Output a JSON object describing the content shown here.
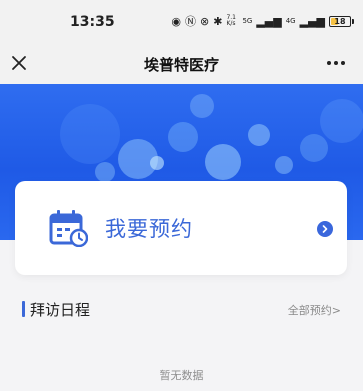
{
  "status_bar": {
    "time": "13:35",
    "network_label": "5G",
    "network_label_2": "4G",
    "speed_label": "7.1 K/s",
    "battery": "18"
  },
  "nav": {
    "title": "埃普特医疗",
    "close_icon": "close-icon",
    "more_icon": "more-icon"
  },
  "booking_card": {
    "label": "我要预约",
    "icon": "calendar-clock-icon",
    "arrow_icon": "chevron-right-circle-icon"
  },
  "visit_section": {
    "title": "拜访日程",
    "all_link": "全部预约>",
    "empty_text": "暂无数据"
  },
  "colors": {
    "accent": "#3b68d8",
    "banner": "#1f5ae6",
    "background": "#f4f4f6"
  }
}
